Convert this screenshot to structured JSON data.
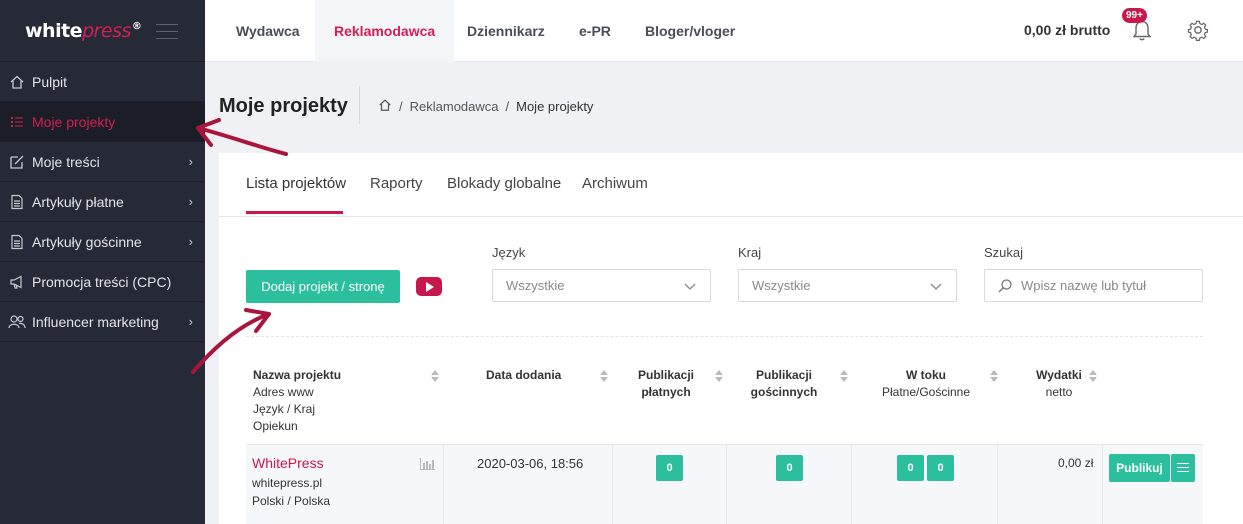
{
  "brand": {
    "name_white": "white",
    "name_press": "press",
    "reg": "®"
  },
  "sidebar": {
    "items": [
      {
        "label": "Pulpit",
        "icon": "home-icon",
        "chevron": false
      },
      {
        "label": "Moje projekty",
        "icon": "list-icon",
        "chevron": false,
        "active": true
      },
      {
        "label": "Moje treści",
        "icon": "edit-icon",
        "chevron": true
      },
      {
        "label": "Artykuły płatne",
        "icon": "document-icon",
        "chevron": true
      },
      {
        "label": "Artykuły gościnne",
        "icon": "document-icon",
        "chevron": true
      },
      {
        "label": "Promocja treści (CPC)",
        "icon": "megaphone-icon",
        "chevron": false
      },
      {
        "label": "Influencer marketing",
        "icon": "users-icon",
        "chevron": true
      }
    ]
  },
  "topbar": {
    "tabs": [
      "Wydawca",
      "Reklamodawca",
      "Dziennikarz",
      "e-PR",
      "Bloger/vloger"
    ],
    "active_tab": "Reklamodawca",
    "balance": "0,00 zł brutto",
    "notif_badge": "99+"
  },
  "page": {
    "title": "Moje projekty",
    "breadcrumb": [
      "Reklamodawca",
      "Moje projekty"
    ]
  },
  "tabs": [
    "Lista projektów",
    "Raporty",
    "Blokady globalne",
    "Archiwum"
  ],
  "filters": {
    "add_button": "Dodaj projekt / stronę",
    "language": {
      "label": "Język",
      "value": "Wszystkie"
    },
    "country": {
      "label": "Kraj",
      "value": "Wszystkie"
    },
    "search": {
      "label": "Szukaj",
      "placeholder": "Wpisz nazwę lub tytuł"
    }
  },
  "table": {
    "headers": {
      "name": {
        "title": "Nazwa projektu",
        "sub": [
          "Adres www",
          "Język / Kraj",
          "Opiekun"
        ]
      },
      "date": {
        "title": "Data dodania"
      },
      "paid": {
        "title": [
          "Publikacji",
          "płatnych"
        ]
      },
      "guest": {
        "title": [
          "Publikacji",
          "gościnnych"
        ]
      },
      "inprogress": {
        "title": "W toku",
        "sub": "Płatne/Gościnne"
      },
      "spend": {
        "title": "Wydatki",
        "sub": "netto"
      }
    },
    "rows": [
      {
        "name": "WhitePress",
        "url": "whitepress.pl",
        "lang_country": "Polski / Polska",
        "date": "2020-03-06, 18:56",
        "paid": "0",
        "guest": "0",
        "inprogress_paid": "0",
        "inprogress_guest": "0",
        "spend": "0,00 zł",
        "publish_label": "Publikuj"
      }
    ]
  },
  "colors": {
    "accent": "#c8174a",
    "teal": "#2bbf9e",
    "sidebar": "#262a36"
  }
}
